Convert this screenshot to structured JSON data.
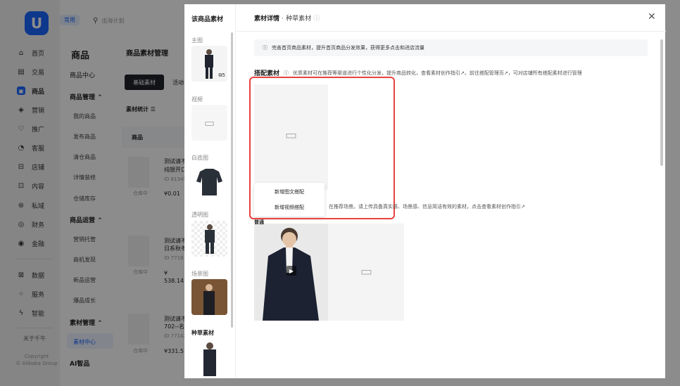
{
  "leftnav": {
    "logo": "U",
    "items": [
      {
        "label": "首页",
        "icon": "home-icon"
      },
      {
        "label": "交易",
        "icon": "trade-icon"
      },
      {
        "label": "商品",
        "icon": "goods-icon",
        "active": true
      },
      {
        "label": "营销",
        "icon": "marketing-icon"
      },
      {
        "label": "推广",
        "icon": "promotion-icon"
      },
      {
        "label": "客服",
        "icon": "service-icon"
      },
      {
        "label": "店铺",
        "icon": "store-icon"
      },
      {
        "label": "内容",
        "icon": "content-icon"
      },
      {
        "label": "私域",
        "icon": "private-icon"
      },
      {
        "label": "财务",
        "icon": "finance-icon"
      },
      {
        "label": "金融",
        "icon": "loan-icon"
      },
      {
        "label": "数据",
        "icon": "data-icon"
      },
      {
        "label": "服务",
        "icon": "apps-icon"
      },
      {
        "label": "智能",
        "icon": "ai-icon"
      }
    ],
    "about": "关于千牛",
    "copyright1": "Copyright",
    "copyright2": "© Alibaba Group"
  },
  "topbar": {
    "common_tab": "常用",
    "search_placeholder": "出海计划"
  },
  "subnav": {
    "title": "商品",
    "center": "商品中心",
    "group1": "商品管理",
    "items1": [
      "我的商品",
      "发布商品",
      "清仓商品",
      "详情装修",
      "仓储库存"
    ],
    "group2": "商品运营",
    "items2": [
      "营销托管",
      "商机发现",
      "新品运营",
      "爆品成长"
    ],
    "group3": "素材管理",
    "items3": [
      "素材中心"
    ],
    "ai": "AI智品"
  },
  "content": {
    "title": "商品素材管理",
    "tab_basic": "基础素材",
    "tab_activity": "活动",
    "stats": "素材统计",
    "col_goods": "商品",
    "rows": [
      {
        "name1": "测试请不",
        "name2": "纯银开口",
        "id": "ID 81345",
        "status": "仓库中",
        "price": "¥0.01"
      },
      {
        "name1": "测试请不",
        "name2": "日系秋冬",
        "id": "ID 7718",
        "status": "仓库中",
        "price": "¥",
        "price2": "538.14 -"
      },
      {
        "name1": "测试请不",
        "name2": "702--名",
        "id": "ID 77142",
        "status": "仓库中",
        "price": "¥331.5"
      }
    ]
  },
  "mid": {
    "title": "该商品素材",
    "main_label": "主图",
    "main_count": "5",
    "video_label": "视频",
    "white_label": "白底图",
    "transparent_label": "透明图",
    "scene_label": "场景图",
    "grass_label": "种草素材"
  },
  "right": {
    "title_main": "素材详情",
    "title_sep": "·",
    "title_sub": "种草素材",
    "notice": "完善首页商品素材，提升首页商品分发效果，获得更多点击和进店流量",
    "section_title": "搭配素材",
    "section_desc": "优质素材可在推荐等渠道进行个性化分发，提升商品转化，查看素材创作指引↗。前往搭配管理页↗，可对店铺所有搭配素材进行管理",
    "menu_item1": "新增图文搭配",
    "menu_item2": "新增视频搭配",
    "desc2": "在推荐场景。请上传具备真实感、场景感、信息简洁有效的素材。点击查看素材创作指引↗",
    "tag": "普通"
  },
  "colors": {
    "accent": "#1a66ff",
    "highlight": "#e8423f"
  }
}
